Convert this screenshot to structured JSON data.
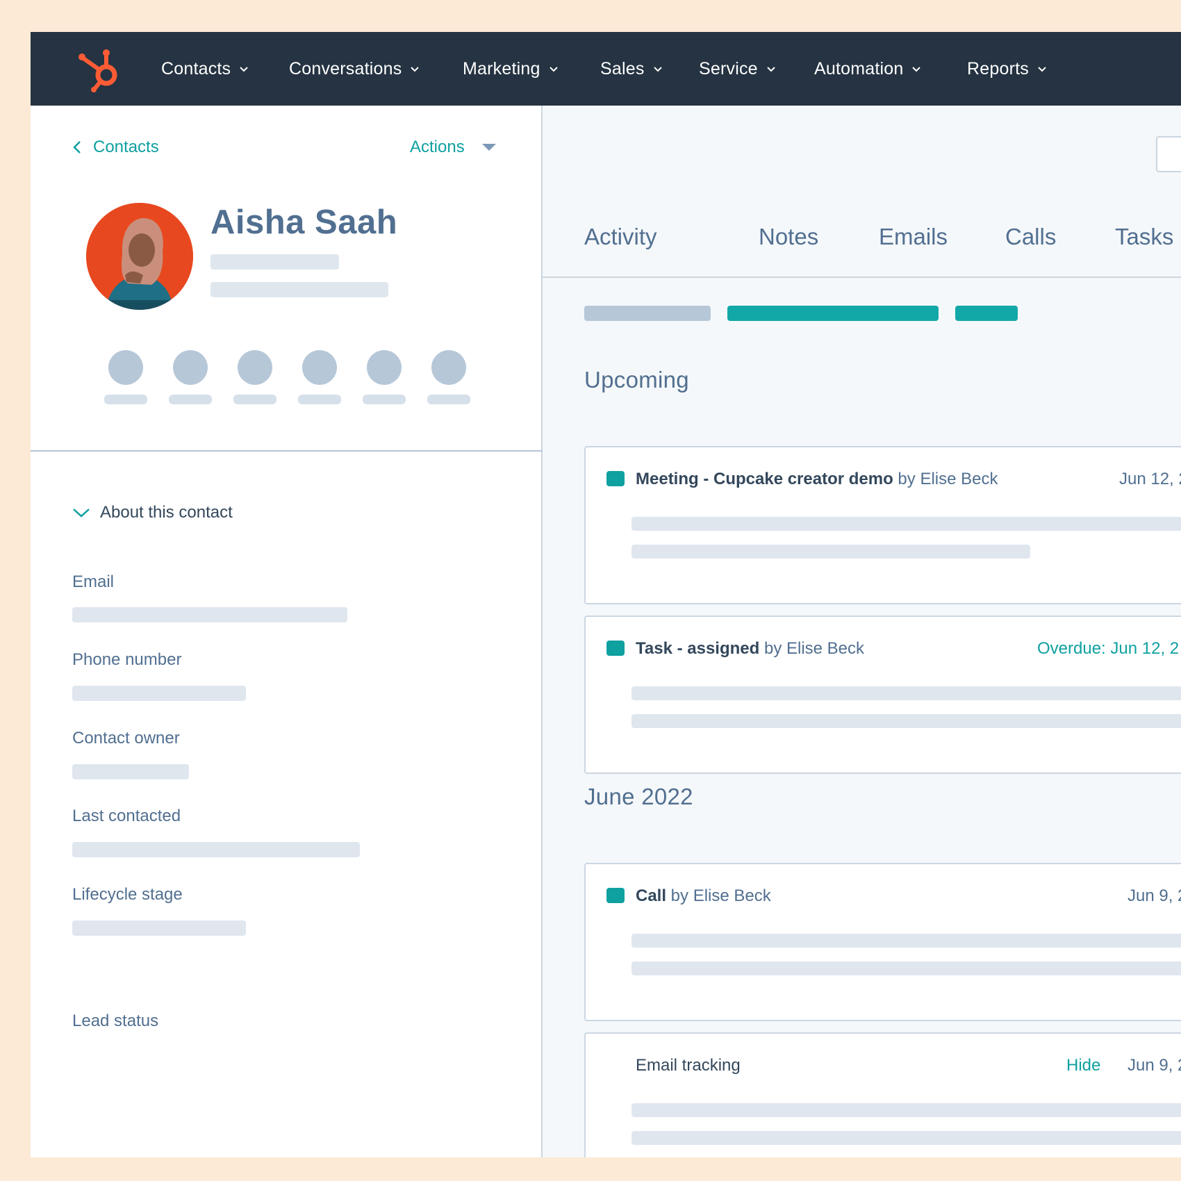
{
  "nav": {
    "items": [
      {
        "label": "Contacts"
      },
      {
        "label": "Conversations"
      },
      {
        "label": "Marketing"
      },
      {
        "label": "Sales"
      },
      {
        "label": "Service"
      },
      {
        "label": "Automation"
      },
      {
        "label": "Reports"
      }
    ],
    "logo_icon": "hubspot-sprocket-icon",
    "dropdown_icon": "chevron-down-icon"
  },
  "sidebar": {
    "back_label": "Contacts",
    "actions_label": "Actions",
    "contact_name": "Aisha Saah",
    "about_label": "About this contact",
    "fields": [
      {
        "label": "Email"
      },
      {
        "label": "Phone number"
      },
      {
        "label": "Contact owner"
      },
      {
        "label": "Last contacted"
      },
      {
        "label": "Lifecycle stage"
      },
      {
        "label": "Lead status"
      }
    ]
  },
  "main": {
    "tabs": [
      {
        "label": "Activity"
      },
      {
        "label": "Notes"
      },
      {
        "label": "Emails"
      },
      {
        "label": "Calls"
      },
      {
        "label": "Tasks"
      }
    ],
    "upcoming_title": "Upcoming",
    "month_title": "June 2022",
    "cards": [
      {
        "strong": "Meeting - Cupcake creator demo",
        "light": " by Elise Beck",
        "date": "Jun 12, 2"
      },
      {
        "strong": "Task - assigned",
        "light": " by Elise Beck",
        "date": "Overdue: Jun 12, 2"
      },
      {
        "strong": "Call",
        "light": " by Elise Beck",
        "date": "Jun 9, 2"
      },
      {
        "strong": "Email tracking",
        "light": "",
        "hide": "Hide",
        "date": "Jun 9, 2"
      }
    ]
  },
  "colors": {
    "nav_bg": "#253342",
    "accent": "#0fa0a0",
    "brand": "#ff5c35",
    "page_bg": "#fcead6"
  }
}
